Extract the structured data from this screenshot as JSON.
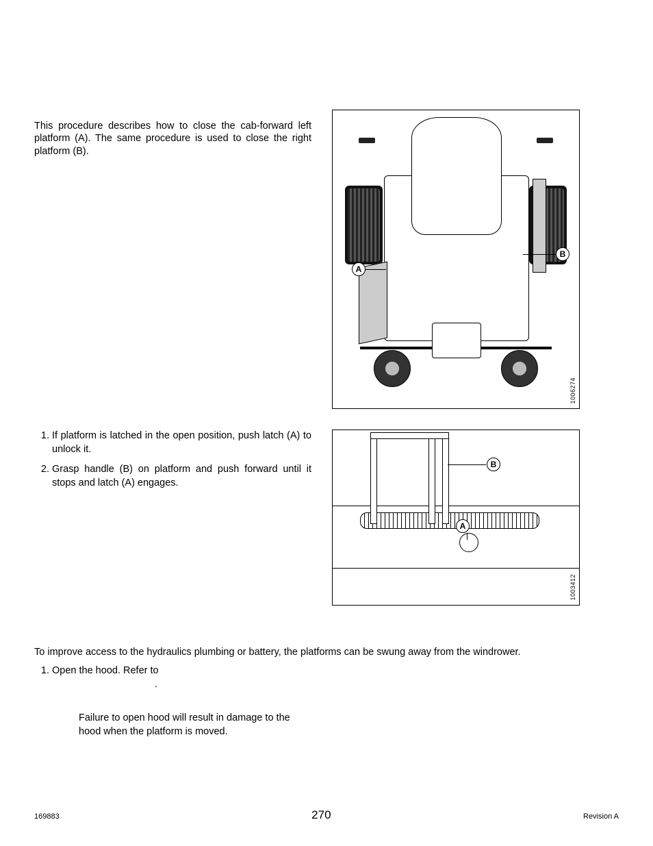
{
  "sectionA": {
    "intro": "This procedure describes how to close the cab-forward left platform (A). The same procedure is used to close the right platform (B).",
    "figure1": {
      "callout_a": "A",
      "callout_b": "B",
      "id": "1006274"
    },
    "steps": [
      "If platform is latched in the open position, push latch (A) to unlock it.",
      "Grasp handle (B) on platform and push forward until it stops and latch (A) engages."
    ],
    "figure2": {
      "callout_a": "A",
      "callout_b": "B",
      "id": "1003412"
    }
  },
  "sectionB": {
    "intro": "To improve access to the hydraulics plumbing or battery, the platforms can be swung away from the windrower.",
    "step1_prefix": "Open the hood.  Refer to",
    "step1_suffix": ".",
    "important": "Failure to open hood will result in damage to the hood when the platform is moved."
  },
  "footer": {
    "left": "169883",
    "center": "270",
    "right": "Revision A"
  }
}
